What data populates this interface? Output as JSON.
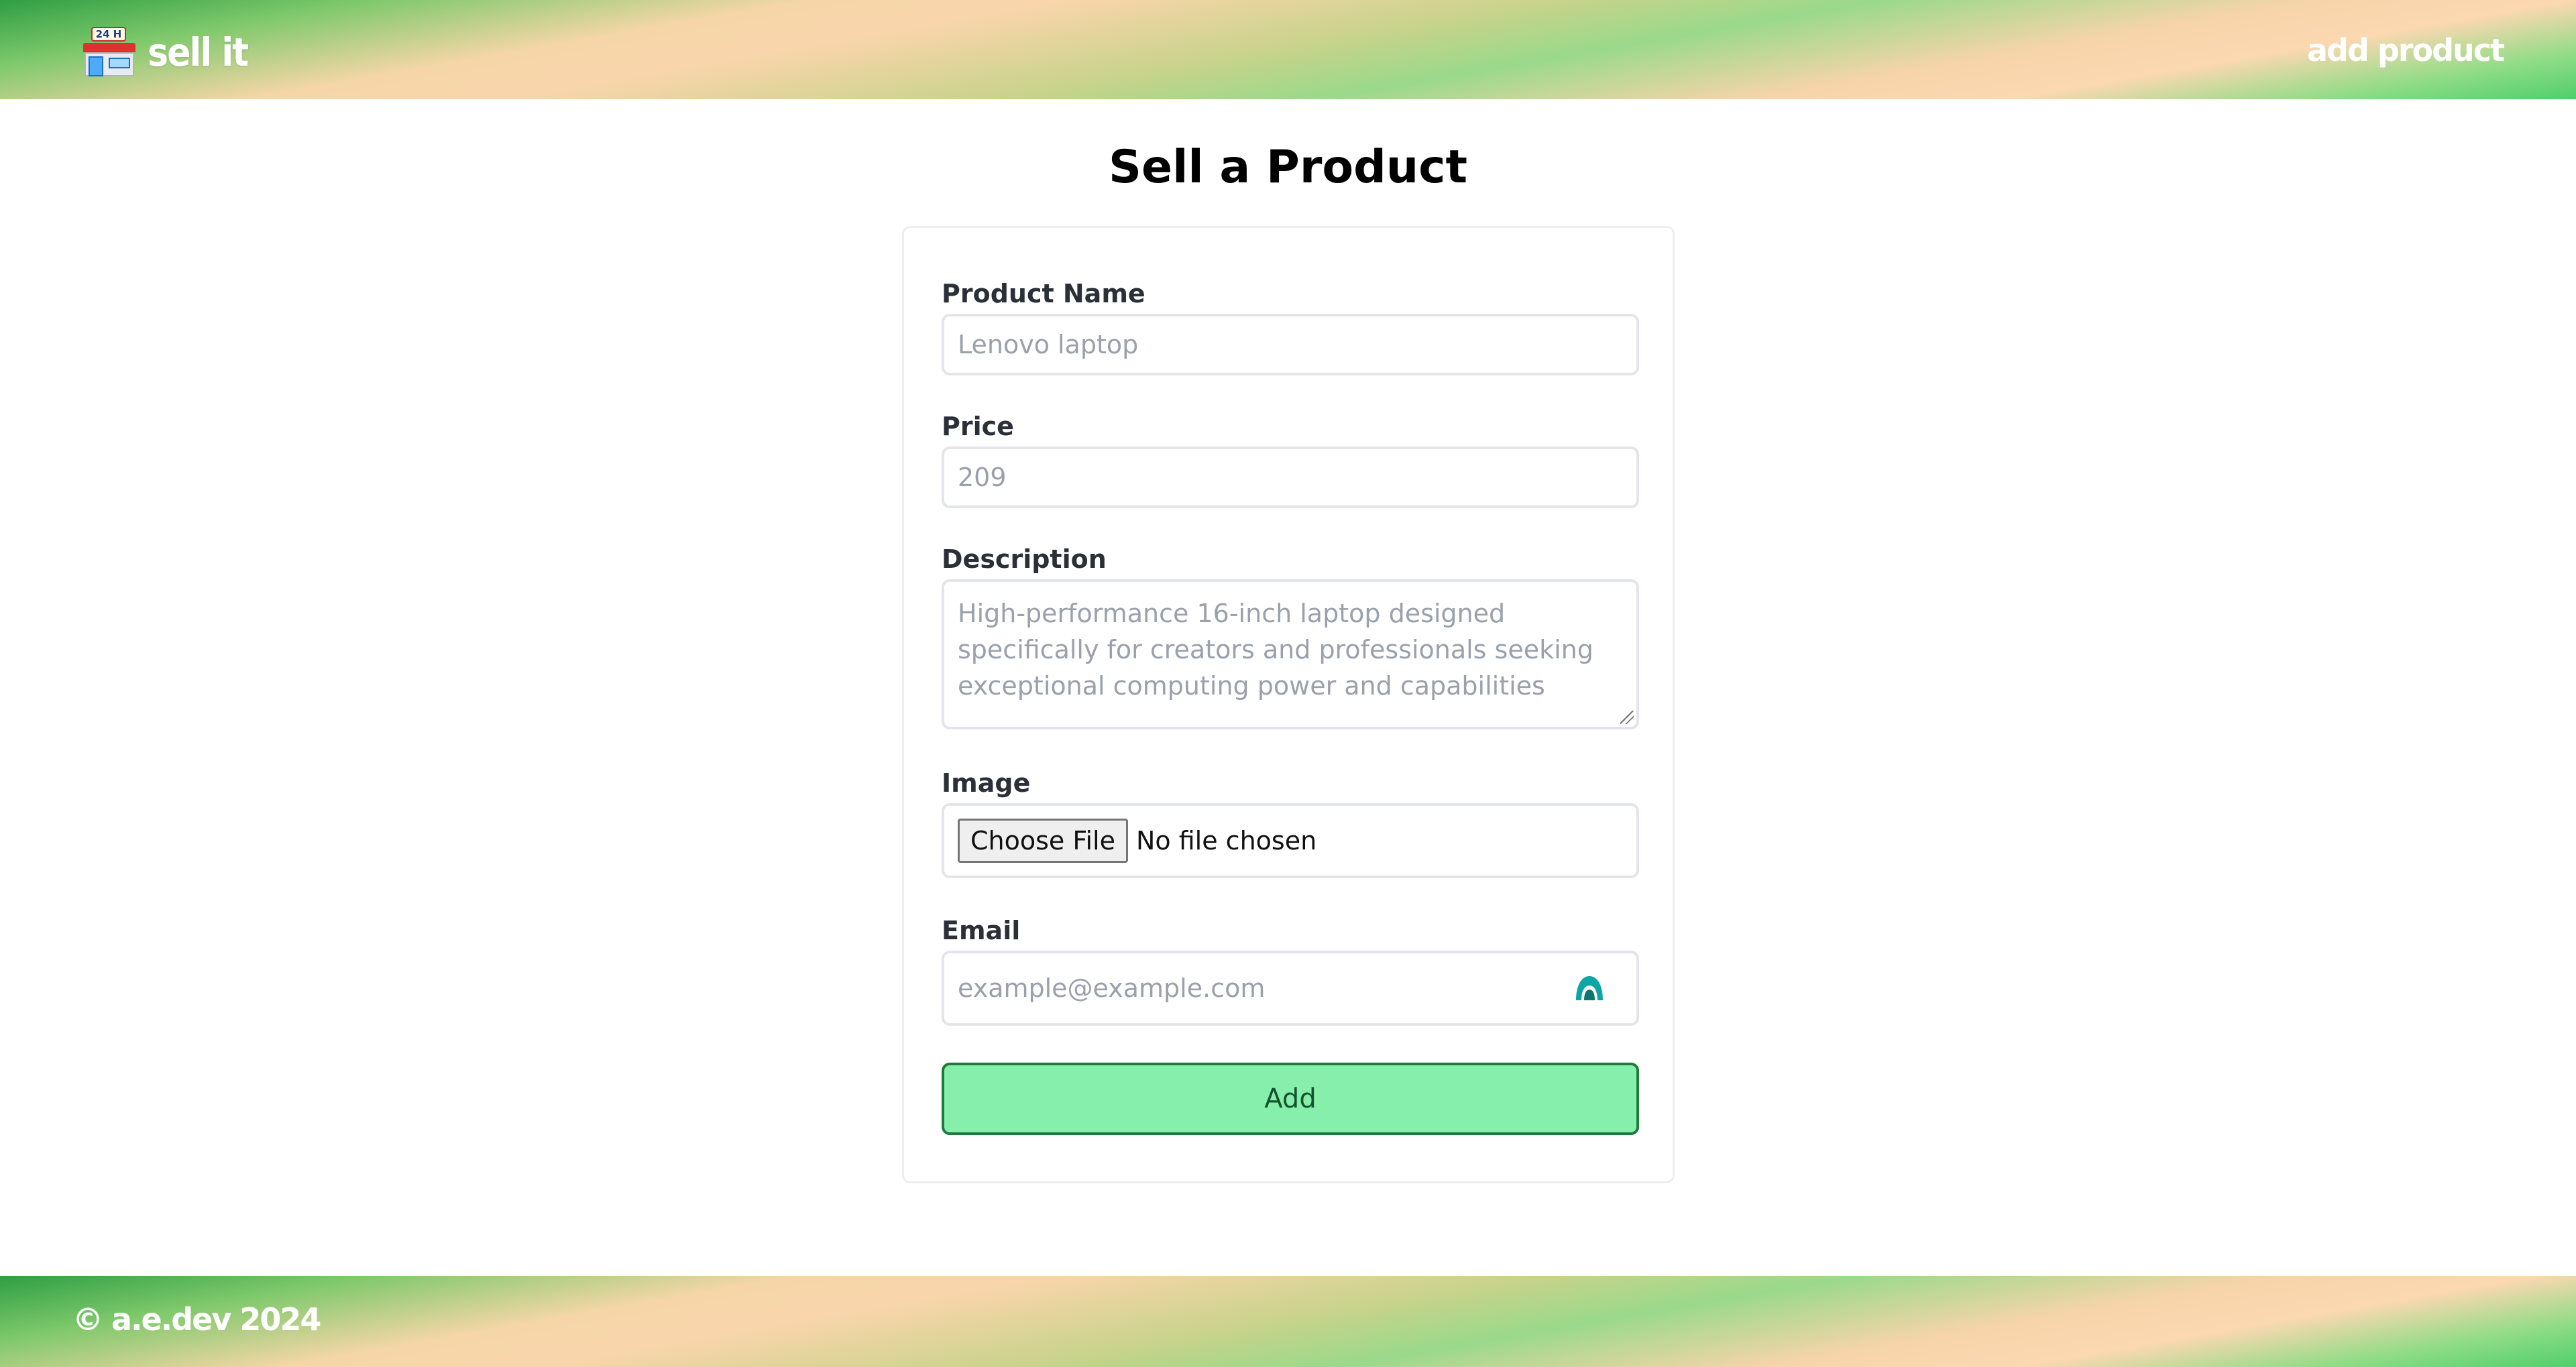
{
  "header": {
    "brand_name": "sell it",
    "brand_icon": "convenience-store-icon",
    "brand_icon_sign": "24 H",
    "nav_link": "add product"
  },
  "main": {
    "title": "Sell a Product",
    "form": {
      "product_name": {
        "label": "Product Name",
        "placeholder": "Lenovo laptop"
      },
      "price": {
        "label": "Price",
        "placeholder": "209"
      },
      "description": {
        "label": "Description",
        "placeholder": "High-performance 16-inch laptop designed specifically for creators and professionals seeking exceptional computing power and capabilities"
      },
      "image": {
        "label": "Image",
        "button_label": "Choose File",
        "status": "No file chosen"
      },
      "email": {
        "label": "Email",
        "placeholder": "example@example.com",
        "icon": "password-manager-icon"
      },
      "submit_label": "Add"
    }
  },
  "footer": {
    "text": "© a.e.dev 2024"
  },
  "colors": {
    "button_fill": "#86efac",
    "button_border": "#1e7a3c",
    "header_gradient": [
      "#2f9e44",
      "#f9d5ab",
      "#4fcf6b"
    ]
  }
}
